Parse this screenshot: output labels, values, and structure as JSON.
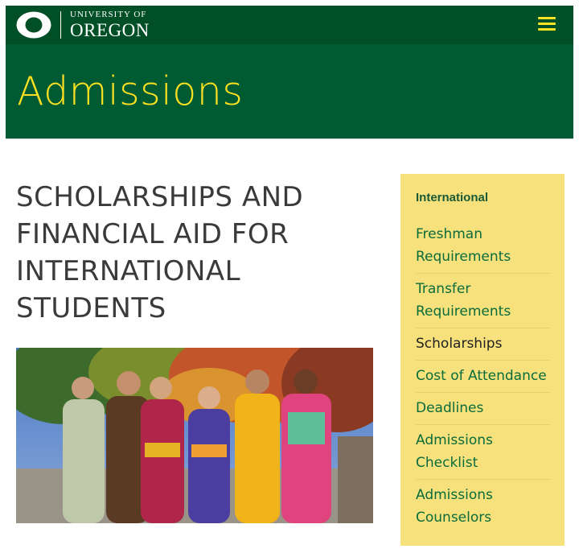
{
  "header": {
    "university_line": "UNIVERSITY OF",
    "name_line": "OREGON",
    "logo_icon": "uo-o-icon",
    "menu_icon": "hamburger-menu-icon"
  },
  "banner": {
    "title": "Admissions"
  },
  "main": {
    "title": "SCHOLARSHIPS AND FINANCIAL AID FOR INTERNATIONAL STUDENTS"
  },
  "sidebar": {
    "heading": "International",
    "items": [
      {
        "label": "Freshman Requirements"
      },
      {
        "label": "Transfer Requirements"
      },
      {
        "label": "Scholarships"
      },
      {
        "label": "Cost of Attendance"
      },
      {
        "label": "Deadlines"
      },
      {
        "label": "Admissions Checklist"
      },
      {
        "label": "Admissions Counselors"
      }
    ]
  },
  "colors": {
    "uo_green": "#004f27",
    "banner_green": "#005a32",
    "uo_yellow": "#fce122",
    "sidebar_bg": "#f7e17c",
    "link_green": "#0a6b3b"
  }
}
